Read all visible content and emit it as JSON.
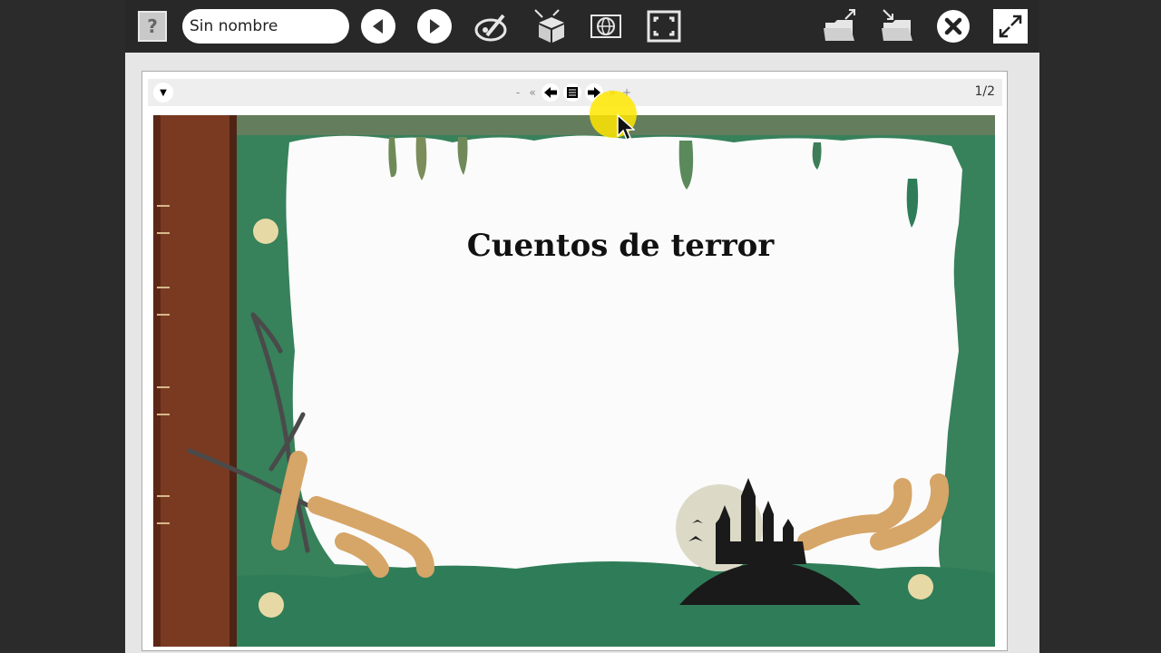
{
  "toolbar": {
    "help_label": "?",
    "name_value": "Sin nombre",
    "icons": [
      "help-icon",
      "back-icon",
      "forward-icon",
      "paint-icon",
      "box-icon",
      "globe-icon",
      "fullscreen-icon",
      "folder-open-icon",
      "folder-save-icon",
      "close-icon",
      "expand-icon"
    ]
  },
  "viewer": {
    "nav": {
      "minus": "-",
      "first": "«",
      "prev": "🡄",
      "list": "☰",
      "next": "🡆",
      "last": "»",
      "plus": "+"
    },
    "page_indicator": "1/2",
    "slide_title": "Cuentos de terror"
  },
  "colors": {
    "toolbar_bg": "#282828",
    "frame_green": "#2e7a56",
    "book_brown": "#7a3a22",
    "tentacle": "#d6a568",
    "highlight": "#ffe600"
  }
}
